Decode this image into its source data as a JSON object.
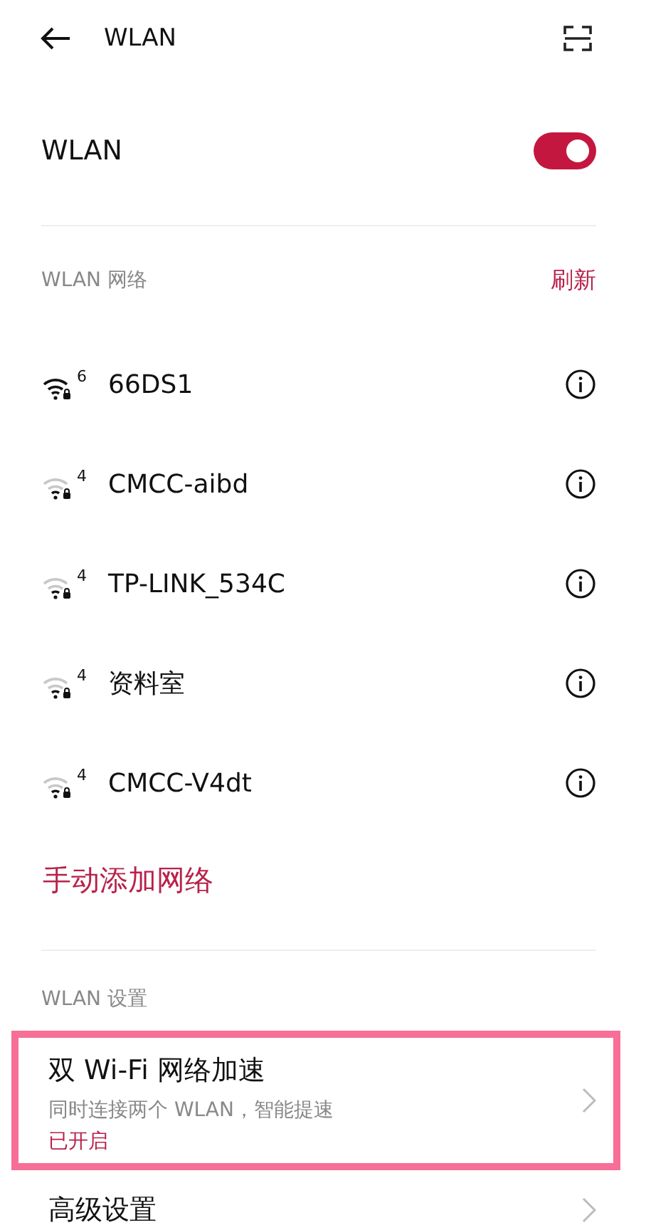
{
  "header": {
    "title": "WLAN"
  },
  "master": {
    "label": "WLAN",
    "on": true
  },
  "networks_section": {
    "title": "WLAN 网络",
    "action": "刷新"
  },
  "networks": [
    {
      "name": "66DS1",
      "generation": "6",
      "full_signal": true
    },
    {
      "name": "CMCC-aibd",
      "generation": "4",
      "full_signal": false
    },
    {
      "name": "TP-LINK_534C",
      "generation": "4",
      "full_signal": false
    },
    {
      "name": "资料室",
      "generation": "4",
      "full_signal": false
    },
    {
      "name": "CMCC-V4dt",
      "generation": "4",
      "full_signal": false
    }
  ],
  "add_network": "手动添加网络",
  "settings_section": {
    "title": "WLAN 设置"
  },
  "settings": [
    {
      "title": "双 Wi-Fi 网络加速",
      "subtitle": "同时连接两个 WLAN，智能提速",
      "status": "已开启",
      "highlighted": true
    },
    {
      "title": "高级设置",
      "highlighted": false
    }
  ]
}
